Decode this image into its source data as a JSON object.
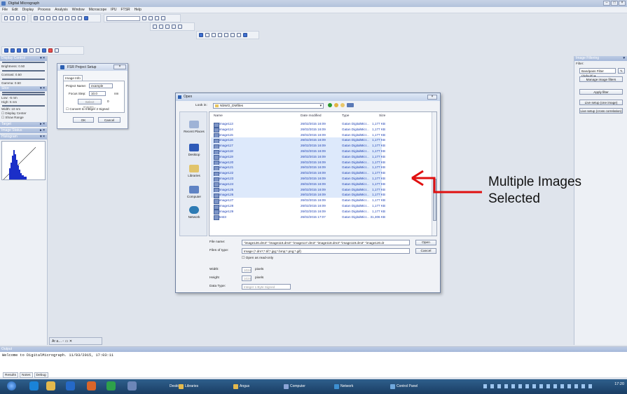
{
  "app": {
    "title": "Digital Micrograph",
    "menus": [
      "File",
      "Edit",
      "Display",
      "Process",
      "Analysis",
      "Window",
      "Microscope",
      "IPU",
      "FTSR",
      "Help"
    ]
  },
  "left_panel": {
    "display_control": {
      "title": "Display Control",
      "brightness": "Brightness: 0.50",
      "contrast": "Contrast: 0.50",
      "gamma": "Gamma: 0.50"
    },
    "slice": {
      "title": "Slice",
      "low": "Low: -5 nm",
      "high": "High: 5 nm",
      "width": "Width: 10 nm",
      "display_center": "Display Center",
      "show_range": "Show Range"
    },
    "target": "Target",
    "image_status": "Image Status",
    "histogram": "Histogram"
  },
  "fsr_dialog": {
    "title": "FSR Project Setup",
    "tab": "Image Info",
    "project_name_label": "Project Name:",
    "project_name_value": "example",
    "focus_step_label": "Focus Step:",
    "focus_step_value": "10.0",
    "focus_step_unit": "nm",
    "select_images_label": "Select Images...",
    "select_images_count": "0",
    "convert_label": "Convert to Integer 2 Signed",
    "ok": "OK",
    "cancel": "Cancel"
  },
  "open_dialog": {
    "title": "Open",
    "look_in_label": "Look in:",
    "look_in_value": "NbWO_DMfiles",
    "places": [
      "Recent Places",
      "Desktop",
      "Libraries",
      "Computer",
      "Network"
    ],
    "columns": {
      "name": "Name",
      "date": "Date modified",
      "type": "Type",
      "size": "Size"
    },
    "files": [
      {
        "name": "image113",
        "date": "26/02/2015 16:09",
        "type": "Gatan DigitalMicr...",
        "size": "1,177 KB",
        "selected": false
      },
      {
        "name": "image114",
        "date": "26/02/2015 16:09",
        "type": "Gatan DigitalMicr...",
        "size": "1,177 KB",
        "selected": false
      },
      {
        "name": "image115",
        "date": "26/02/2015 16:09",
        "type": "Gatan DigitalMicr...",
        "size": "1,177 KB",
        "selected": false
      },
      {
        "name": "image116",
        "date": "26/02/2015 16:09",
        "type": "Gatan DigitalMicr...",
        "size": "1,177 KB",
        "selected": true
      },
      {
        "name": "image117",
        "date": "26/02/2015 16:09",
        "type": "Gatan DigitalMicr...",
        "size": "1,177 KB",
        "selected": true
      },
      {
        "name": "image118",
        "date": "26/02/2015 16:09",
        "type": "Gatan DigitalMicr...",
        "size": "1,177 KB",
        "selected": true
      },
      {
        "name": "image119",
        "date": "26/02/2015 16:09",
        "type": "Gatan DigitalMicr...",
        "size": "1,177 KB",
        "selected": true
      },
      {
        "name": "image120",
        "date": "26/02/2015 16:09",
        "type": "Gatan DigitalMicr...",
        "size": "1,177 KB",
        "selected": true
      },
      {
        "name": "image121",
        "date": "26/02/2015 16:09",
        "type": "Gatan DigitalMicr...",
        "size": "1,177 KB",
        "selected": true
      },
      {
        "name": "image122",
        "date": "26/02/2015 16:09",
        "type": "Gatan DigitalMicr...",
        "size": "1,177 KB",
        "selected": true
      },
      {
        "name": "image123",
        "date": "26/02/2015 16:09",
        "type": "Gatan DigitalMicr...",
        "size": "1,177 KB",
        "selected": true
      },
      {
        "name": "image124",
        "date": "26/02/2015 16:09",
        "type": "Gatan DigitalMicr...",
        "size": "1,177 KB",
        "selected": true
      },
      {
        "name": "image125",
        "date": "26/02/2015 16:09",
        "type": "Gatan DigitalMicr...",
        "size": "1,177 KB",
        "selected": true
      },
      {
        "name": "image126",
        "date": "26/02/2015 16:09",
        "type": "Gatan DigitalMicr...",
        "size": "1,177 KB",
        "selected": true
      },
      {
        "name": "image127",
        "date": "26/02/2015 16:09",
        "type": "Gatan DigitalMicr...",
        "size": "1,177 KB",
        "selected": false
      },
      {
        "name": "image128",
        "date": "26/02/2015 16:09",
        "type": "Gatan DigitalMicr...",
        "size": "1,177 KB",
        "selected": false
      },
      {
        "name": "image129",
        "date": "26/02/2015 16:09",
        "type": "Gatan DigitalMicr...",
        "size": "1,177 KB",
        "selected": false
      },
      {
        "name": "test3",
        "date": "26/02/2015 17:07",
        "type": "Gatan DigitalMicr...",
        "size": "31,306 KB",
        "selected": false
      }
    ],
    "file_name_label": "File name:",
    "file_name_value": "\"image126.dm3\" \"image116.dm3\" \"image117.dm3\" \"image118.dm3\" \"image119.dm3\" \"image120.dr",
    "files_of_type_label": "Files of type:",
    "files_of_type_value": "Image (*.dm?;*.tif;*.jpg;*.bmp;*.png;*.gif)",
    "read_only_label": "Open as read-only",
    "open": "Open",
    "cancel": "Cancel",
    "width_label": "Width:",
    "width_value": "1024",
    "width_unit": "pixels",
    "height_label": "Height",
    "height_value": "1024",
    "height_unit": "pixels",
    "data_type_label": "Data Type:",
    "data_type_value": "Integer 1 Byte Signed"
  },
  "right_panel": {
    "title": "Image Filtering",
    "filter_label": "Filter:",
    "filter_value": "Bandpass Filter (default)",
    "manage": "Manage image filters",
    "apply": "Apply filter",
    "live_one": "Live setup (one image)",
    "live_cross": "Live setup (cross correlation)"
  },
  "output": {
    "title": "Output",
    "text": "Welcome to DigitalMicrograph.  11/03/2015, 17:03:11",
    "tabs": [
      "Results",
      "Notes",
      "Debug"
    ]
  },
  "taskbar": {
    "items": [
      "Libraries",
      "Angus",
      "Computer",
      "Network",
      "Control Panel"
    ],
    "desktop_label": "Desktop",
    "time": "17:20"
  },
  "annotation": {
    "line1": "Multiple Images",
    "line2": "Selected",
    "arrow_color": "#e01010"
  }
}
